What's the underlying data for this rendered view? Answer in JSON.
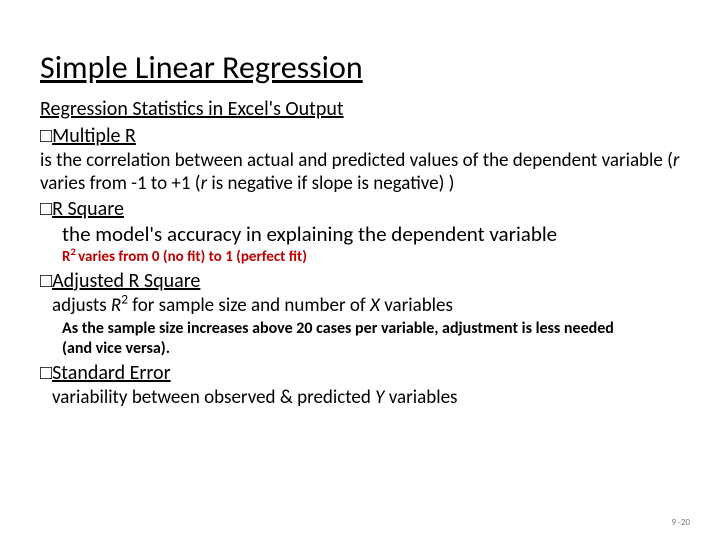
{
  "title": "Simple Linear Regression",
  "section": "Regression Statistics in Excel's Output",
  "square": "□",
  "items": {
    "multipleR": {
      "head": "Multiple R",
      "body_pre": " is the correlation between actual and predicted values of the dependent variable   (",
      "r1": "r",
      "body_mid": " varies from -1 to +1 (",
      "r2": "r",
      "body_post": " is negative if slope is negative) )"
    },
    "rsquare": {
      "head": "R Square",
      "desc": "the model's accuracy in explaining the dependent variable",
      "note_pre": "R",
      "note_sup": "2 ",
      "note_post": "varies from 0 (no fit) to 1 (perfect fit)"
    },
    "adjR": {
      "head": "Adjusted R Square",
      "desc_pre": "adjusts ",
      "desc_r": "R",
      "desc_sup": "2",
      "desc_mid": " for sample size and number of ",
      "desc_x": "X",
      "desc_post": " variables",
      "note": "As the sample size increases above 20 cases per variable, adjustment is less needed (and vice versa)."
    },
    "stdErr": {
      "head": "Standard Error",
      "desc_pre": "variability between observed & predicted ",
      "desc_y": "Y",
      "desc_post": " variables"
    }
  },
  "page": "9 -20"
}
